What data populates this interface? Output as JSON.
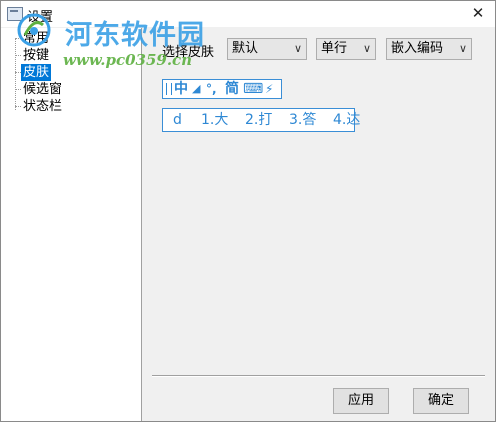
{
  "window": {
    "title": "设置",
    "close_glyph": "✕"
  },
  "watermark": {
    "site_name": "河东软件园",
    "url": "www.pc0359.cn"
  },
  "tree": {
    "items": [
      {
        "label": "常用",
        "selected": false
      },
      {
        "label": "按键",
        "selected": false
      },
      {
        "label": "皮肤",
        "selected": true
      },
      {
        "label": "候选窗",
        "selected": false
      },
      {
        "label": "状态栏",
        "selected": false
      }
    ]
  },
  "skin": {
    "label": "选择皮肤",
    "skin_select": "默认",
    "line_select": "单行",
    "encoding_select": "嵌入编码",
    "dropdown_glyph": "∨"
  },
  "preview": {
    "toolbar": {
      "chinese": "中",
      "moon": "◢",
      "punct": "°,",
      "simplified": "简",
      "keyboard": "⌨",
      "bolt": "⚡"
    },
    "candidates": {
      "input": "d",
      "items": [
        "1.大",
        "2.打",
        "3.答",
        "4.达"
      ]
    }
  },
  "buttons": {
    "apply": "应用",
    "confirm": "确定"
  },
  "colors": {
    "accent": "#0078d7",
    "preview_blue": "#2e88d4",
    "watermark_blue": "#3aa0e6",
    "watermark_green": "#5db040"
  }
}
